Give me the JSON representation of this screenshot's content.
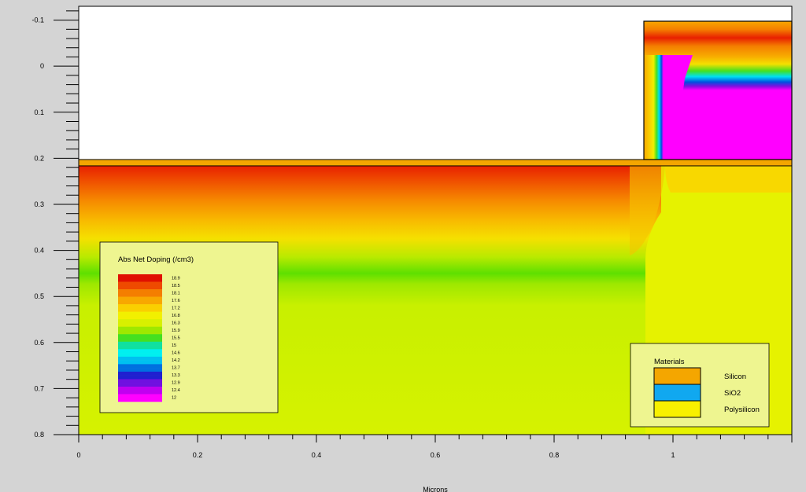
{
  "chart_data": {
    "type": "heatmap",
    "title": "",
    "xlabel": "Microns",
    "ylabel": "",
    "xlim": [
      0,
      1.2
    ],
    "ylim": [
      -0.13,
      0.8
    ],
    "y_inverted": true,
    "grid": false,
    "x_ticks": [
      "0",
      "0.2",
      "0.4",
      "0.6",
      "0.8",
      "1"
    ],
    "x_tick_values": [
      0,
      0.2,
      0.4,
      0.6,
      0.8,
      1.0
    ],
    "y_ticks": [
      "-0.1",
      "0",
      "0.1",
      "0.2",
      "0.3",
      "0.4",
      "0.5",
      "0.6",
      "0.7",
      "0.8"
    ],
    "y_tick_values": [
      -0.1,
      0,
      0.1,
      0.2,
      0.3,
      0.4,
      0.5,
      0.6,
      0.7,
      0.8
    ],
    "quantity": "Abs Net Doping (/cm3)",
    "colorbar": {
      "title": "Abs Net Doping (/cm3)",
      "labels": [
        "18.9",
        "18.5",
        "18.1",
        "17.6",
        "17.2",
        "16.8",
        "16.3",
        "15.9",
        "15.5",
        "15",
        "14.6",
        "14.2",
        "13.7",
        "13.3",
        "12.9",
        "12.4",
        "12"
      ],
      "range": [
        12,
        18.9
      ],
      "colors": [
        "#e01000",
        "#ef4a00",
        "#f47e00",
        "#f8a800",
        "#fad000",
        "#f2f000",
        "#d8f000",
        "#9ee800",
        "#44e020",
        "#10e0a0",
        "#00f0f0",
        "#00c0f0",
        "#0070e0",
        "#2020d0",
        "#7010e0",
        "#c000f0",
        "#ff00ff"
      ]
    },
    "materials_legend": {
      "title": "Materials",
      "items": [
        {
          "name": "Silicon",
          "color": "#f4a600"
        },
        {
          "name": "SiO2",
          "color": "#10a8f0"
        },
        {
          "name": "Polysilicon",
          "color": "#f8f000"
        }
      ]
    },
    "regions": [
      {
        "material": "SiO2",
        "x": [
          0,
          1.2
        ],
        "y": [
          0.2,
          0.215
        ]
      },
      {
        "material": "Polysilicon",
        "x": [
          0.95,
          1.2
        ],
        "y": [
          -0.095,
          0.2
        ]
      },
      {
        "material": "Silicon",
        "x": [
          0,
          1.2
        ],
        "y": [
          0.215,
          0.8
        ]
      }
    ],
    "substrate_bands": [
      {
        "y": [
          0.215,
          0.24
        ],
        "value": 18.7
      },
      {
        "y": [
          0.24,
          0.27
        ],
        "value": 18.0
      },
      {
        "y": [
          0.27,
          0.295
        ],
        "value": 17.3
      },
      {
        "y": [
          0.295,
          0.32
        ],
        "value": 16.7
      },
      {
        "y": [
          0.32,
          0.345
        ],
        "value": 16.2
      },
      {
        "y": [
          0.345,
          0.37
        ],
        "value": 16.6
      },
      {
        "y": [
          0.37,
          0.42
        ],
        "value": 16.9
      },
      {
        "y": [
          0.42,
          0.8
        ],
        "value": 16.9
      }
    ]
  }
}
